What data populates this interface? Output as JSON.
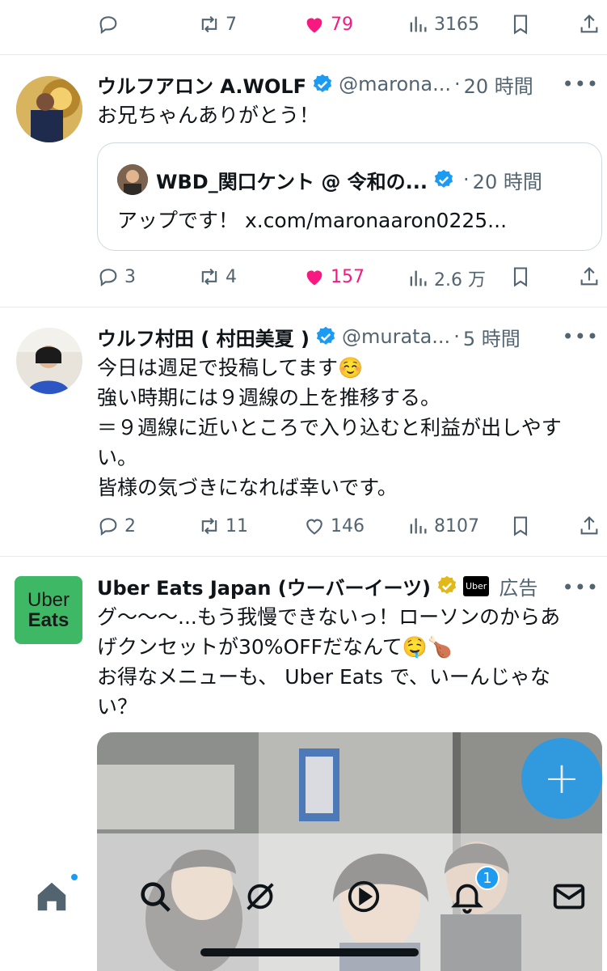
{
  "tweet0": {
    "replies": "",
    "retweets": "7",
    "likes": "79",
    "views": "3165"
  },
  "tweet1": {
    "name": "ウルフアロン A.WOLF",
    "handle": "@marona...",
    "time": "20 時間",
    "text": "お兄ちゃんありがとう！",
    "quote": {
      "name": "WBD_関口ケント @ 令和の...",
      "time": "20 時間",
      "text": "アップです！ x.com/maronaaron0225..."
    },
    "replies": "3",
    "retweets": "4",
    "likes": "157",
    "views": "2.6 万"
  },
  "tweet2": {
    "name": "ウルフ村田 ( 村田美夏 )",
    "handle": "@murata...",
    "time": "5 時間",
    "lines": [
      "今日は週足で投稿してます☺️",
      "強い時期には９週線の上を推移する。",
      "＝９週線に近いところで入り込むと利益が出しやす",
      "い。",
      "皆様の気づきになれば幸いです。"
    ],
    "replies": "2",
    "retweets": "11",
    "likes": "146",
    "views": "8107"
  },
  "tweet3": {
    "name": "Uber Eats Japan (ウーバーイーツ)",
    "badge": "Uber",
    "ad_label": "広告",
    "logo_line1": "Uber",
    "logo_line2": "Eats",
    "lines": [
      "グ〜〜〜...もう我慢できないっ！ローソンのからあ",
      "げクンセットが30%OFFだなんて🤤🍗",
      "お得なメニューも、 Uber Eats で、いーんじゃな",
      "い？"
    ]
  },
  "fab": {
    "label": "+"
  },
  "tabbar": {
    "notification_count": "1"
  },
  "colors": {
    "like": "#f91880",
    "verified": "#1d9bf0",
    "gold": "#e2b719",
    "uber_green": "#3fb866",
    "fab": "#1d9bf0"
  }
}
